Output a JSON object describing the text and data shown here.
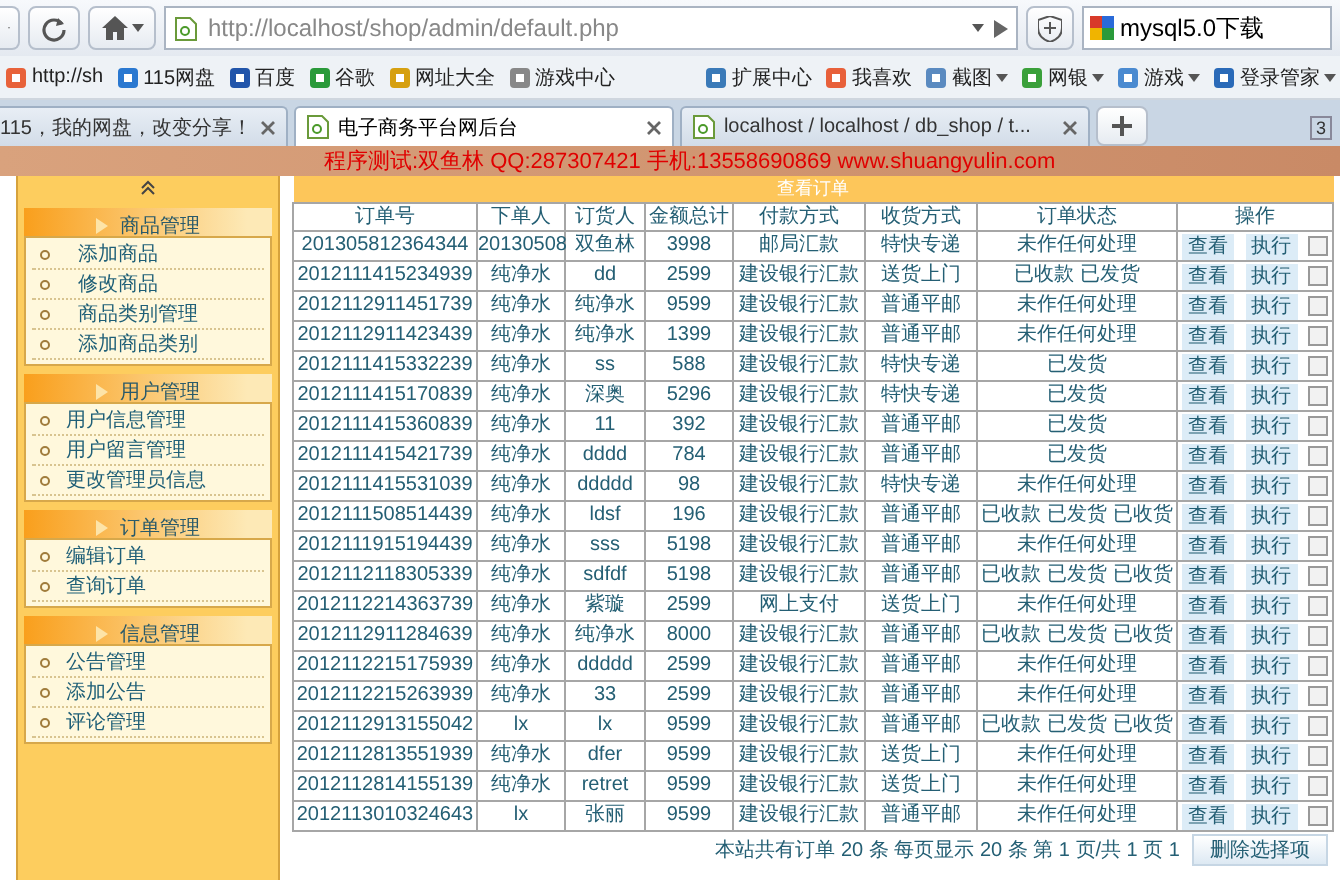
{
  "browser": {
    "url": "http://localhost/shop/admin/default.php",
    "search": "mysql5.0下载",
    "bookmarks": [
      {
        "label": "http://sh",
        "dropdown": false
      },
      {
        "label": "115网盘",
        "dropdown": false
      },
      {
        "label": "百度",
        "dropdown": false
      },
      {
        "label": "谷歌",
        "dropdown": false
      },
      {
        "label": "网址大全",
        "dropdown": false
      },
      {
        "label": "游戏中心",
        "dropdown": false
      }
    ],
    "extensions": [
      {
        "label": "扩展中心",
        "dropdown": false
      },
      {
        "label": "我喜欢",
        "dropdown": false
      },
      {
        "label": "截图",
        "dropdown": true
      },
      {
        "label": "网银",
        "dropdown": true
      },
      {
        "label": "游戏",
        "dropdown": true
      },
      {
        "label": "登录管家",
        "dropdown": true
      }
    ],
    "tabs": [
      {
        "label": "115，我的网盘，改变分享！",
        "selected": false
      },
      {
        "label": "电子商务平台网后台",
        "selected": true
      },
      {
        "label": "localhost / localhost / db_shop / t...",
        "selected": false
      }
    ],
    "tab_count": "3"
  },
  "banner": "程序测试:双鱼林 QQ:287307421 手机:13558690869 www.shuangyulin.com",
  "sidebar": {
    "groups": [
      {
        "title": "商品管理",
        "items": [
          "添加商品",
          "修改商品",
          "商品类别管理",
          "添加商品类别"
        ]
      },
      {
        "title": "用户管理",
        "items": [
          "用户信息管理",
          "用户留言管理",
          "更改管理员信息"
        ]
      },
      {
        "title": "订单管理",
        "items": [
          "编辑订单",
          "查询订单"
        ]
      },
      {
        "title": "信息管理",
        "items": [
          "公告管理",
          "添加公告",
          "评论管理"
        ]
      }
    ]
  },
  "orders": {
    "title": "查看订单",
    "columns": [
      "订单号",
      "下单人",
      "订货人",
      "金额总计",
      "付款方式",
      "收货方式",
      "订单状态",
      "操作"
    ],
    "rows": [
      {
        "cells": [
          "201305812364344",
          "20130508",
          "双鱼林",
          "3998",
          "邮局汇款",
          "特快专递",
          "未作任何处理"
        ],
        "actions": [
          "查看",
          "执行"
        ],
        "checked": false
      },
      {
        "cells": [
          "2012111415234939",
          "纯净水",
          "dd",
          "2599",
          "建设银行汇款",
          "送货上门",
          "已收款 已发货"
        ],
        "actions": [
          "查看",
          "执行"
        ],
        "checked": false
      },
      {
        "cells": [
          "2012112911451739",
          "纯净水",
          "纯净水",
          "9599",
          "建设银行汇款",
          "普通平邮",
          "未作任何处理"
        ],
        "actions": [
          "查看",
          "执行"
        ],
        "checked": false
      },
      {
        "cells": [
          "2012112911423439",
          "纯净水",
          "纯净水",
          "1399",
          "建设银行汇款",
          "普通平邮",
          "未作任何处理"
        ],
        "actions": [
          "查看",
          "执行"
        ],
        "checked": false
      },
      {
        "cells": [
          "2012111415332239",
          "纯净水",
          "ss",
          "588",
          "建设银行汇款",
          "特快专递",
          "已发货"
        ],
        "actions": [
          "查看",
          "执行"
        ],
        "checked": false
      },
      {
        "cells": [
          "2012111415170839",
          "纯净水",
          "深奥",
          "5296",
          "建设银行汇款",
          "特快专递",
          "已发货"
        ],
        "actions": [
          "查看",
          "执行"
        ],
        "checked": false
      },
      {
        "cells": [
          "2012111415360839",
          "纯净水",
          "11",
          "392",
          "建设银行汇款",
          "普通平邮",
          "已发货"
        ],
        "actions": [
          "查看",
          "执行"
        ],
        "checked": false
      },
      {
        "cells": [
          "2012111415421739",
          "纯净水",
          "dddd",
          "784",
          "建设银行汇款",
          "普通平邮",
          "已发货"
        ],
        "actions": [
          "查看",
          "执行"
        ],
        "checked": false
      },
      {
        "cells": [
          "2012111415531039",
          "纯净水",
          "ddddd",
          "98",
          "建设银行汇款",
          "特快专递",
          "未作任何处理"
        ],
        "actions": [
          "查看",
          "执行"
        ],
        "checked": false
      },
      {
        "cells": [
          "2012111508514439",
          "纯净水",
          "ldsf",
          "196",
          "建设银行汇款",
          "普通平邮",
          "已收款 已发货 已收货"
        ],
        "actions": [
          "查看",
          "执行"
        ],
        "checked": false
      },
      {
        "cells": [
          "2012111915194439",
          "纯净水",
          "sss",
          "5198",
          "建设银行汇款",
          "普通平邮",
          "未作任何处理"
        ],
        "actions": [
          "查看",
          "执行"
        ],
        "checked": false
      },
      {
        "cells": [
          "2012112118305339",
          "纯净水",
          "sdfdf",
          "5198",
          "建设银行汇款",
          "普通平邮",
          "已收款 已发货 已收货"
        ],
        "actions": [
          "查看",
          "执行"
        ],
        "checked": false
      },
      {
        "cells": [
          "2012112214363739",
          "纯净水",
          "紫璇",
          "2599",
          "网上支付",
          "送货上门",
          "未作任何处理"
        ],
        "actions": [
          "查看",
          "执行"
        ],
        "checked": false
      },
      {
        "cells": [
          "2012112911284639",
          "纯净水",
          "纯净水",
          "8000",
          "建设银行汇款",
          "普通平邮",
          "已收款 已发货 已收货"
        ],
        "actions": [
          "查看",
          "执行"
        ],
        "checked": false
      },
      {
        "cells": [
          "2012112215175939",
          "纯净水",
          "ddddd",
          "2599",
          "建设银行汇款",
          "普通平邮",
          "未作任何处理"
        ],
        "actions": [
          "查看",
          "执行"
        ],
        "checked": false
      },
      {
        "cells": [
          "2012112215263939",
          "纯净水",
          "33",
          "2599",
          "建设银行汇款",
          "普通平邮",
          "未作任何处理"
        ],
        "actions": [
          "查看",
          "执行"
        ],
        "checked": false
      },
      {
        "cells": [
          "2012112913155042",
          "lx",
          "lx",
          "9599",
          "建设银行汇款",
          "普通平邮",
          "已收款 已发货 已收货"
        ],
        "actions": [
          "查看",
          "执行"
        ],
        "checked": false
      },
      {
        "cells": [
          "2012112813551939",
          "纯净水",
          "dfer",
          "9599",
          "建设银行汇款",
          "送货上门",
          "未作任何处理"
        ],
        "actions": [
          "查看",
          "执行"
        ],
        "checked": false
      },
      {
        "cells": [
          "2012112814155139",
          "纯净水",
          "retret",
          "9599",
          "建设银行汇款",
          "送货上门",
          "未作任何处理"
        ],
        "actions": [
          "查看",
          "执行"
        ],
        "checked": false
      },
      {
        "cells": [
          "2012113010324643",
          "lx",
          "张丽",
          "9599",
          "建设银行汇款",
          "普通平邮",
          "未作任何处理"
        ],
        "actions": [
          "查看",
          "执行"
        ],
        "checked": false
      }
    ],
    "footer": "本站共有订单 20 条 每页显示 20 条 第 1 页/共 1 页 1",
    "delete_button": "删除选择项"
  }
}
